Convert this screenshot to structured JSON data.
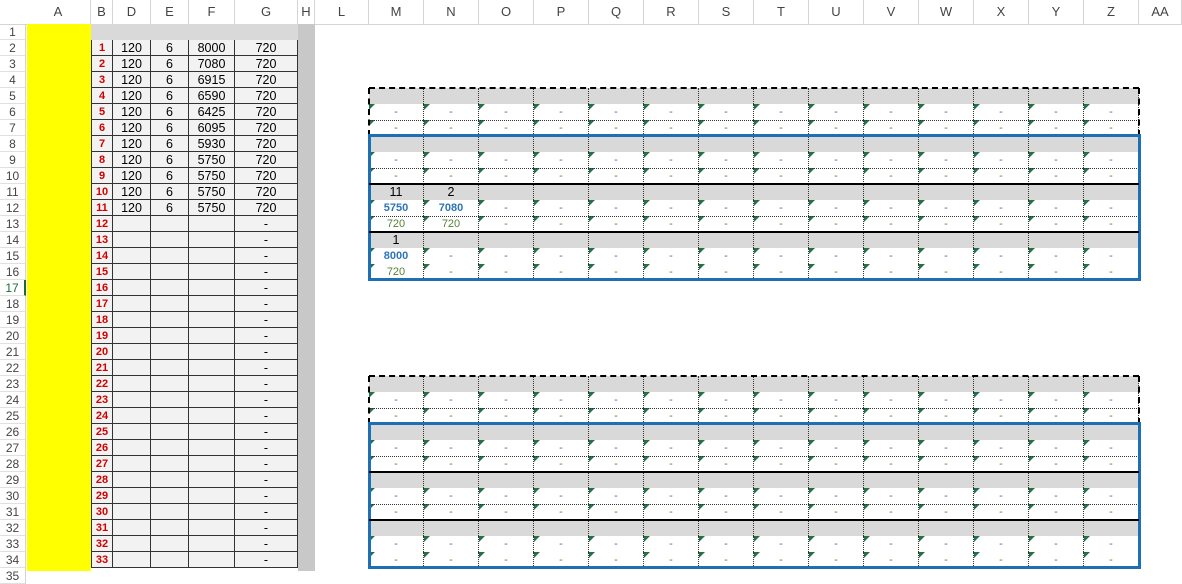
{
  "columns": [
    "A",
    "B",
    "D",
    "E",
    "F",
    "G",
    "H",
    "L",
    "M",
    "N",
    "O",
    "P",
    "Q",
    "R",
    "S",
    "T",
    "U",
    "V",
    "W",
    "X",
    "Y",
    "Z",
    "AA"
  ],
  "rows": [
    "1",
    "2",
    "3",
    "4",
    "5",
    "6",
    "7",
    "8",
    "9",
    "10",
    "11",
    "12",
    "13",
    "14",
    "15",
    "16",
    "17",
    "18",
    "19",
    "20",
    "21",
    "22",
    "23",
    "24",
    "25",
    "26",
    "27",
    "28",
    "29",
    "30",
    "31",
    "32",
    "33",
    "34",
    "35"
  ],
  "selected_row": "17",
  "left_table": {
    "rows": [
      {
        "idx": "1",
        "d": "120",
        "e": "6",
        "f": "8000",
        "g": "720"
      },
      {
        "idx": "2",
        "d": "120",
        "e": "6",
        "f": "7080",
        "g": "720"
      },
      {
        "idx": "3",
        "d": "120",
        "e": "6",
        "f": "6915",
        "g": "720"
      },
      {
        "idx": "4",
        "d": "120",
        "e": "6",
        "f": "6590",
        "g": "720"
      },
      {
        "idx": "5",
        "d": "120",
        "e": "6",
        "f": "6425",
        "g": "720"
      },
      {
        "idx": "6",
        "d": "120",
        "e": "6",
        "f": "6095",
        "g": "720"
      },
      {
        "idx": "7",
        "d": "120",
        "e": "6",
        "f": "5930",
        "g": "720"
      },
      {
        "idx": "8",
        "d": "120",
        "e": "6",
        "f": "5750",
        "g": "720"
      },
      {
        "idx": "9",
        "d": "120",
        "e": "6",
        "f": "5750",
        "g": "720"
      },
      {
        "idx": "10",
        "d": "120",
        "e": "6",
        "f": "5750",
        "g": "720"
      },
      {
        "idx": "11",
        "d": "120",
        "e": "6",
        "f": "5750",
        "g": "720"
      },
      {
        "idx": "12",
        "d": "",
        "e": "",
        "f": "",
        "g": "-"
      },
      {
        "idx": "13",
        "d": "",
        "e": "",
        "f": "",
        "g": "-"
      },
      {
        "idx": "14",
        "d": "",
        "e": "",
        "f": "",
        "g": "-"
      },
      {
        "idx": "15",
        "d": "",
        "e": "",
        "f": "",
        "g": "-"
      },
      {
        "idx": "16",
        "d": "",
        "e": "",
        "f": "",
        "g": "-"
      },
      {
        "idx": "17",
        "d": "",
        "e": "",
        "f": "",
        "g": "-"
      },
      {
        "idx": "18",
        "d": "",
        "e": "",
        "f": "",
        "g": "-"
      },
      {
        "idx": "19",
        "d": "",
        "e": "",
        "f": "",
        "g": "-"
      },
      {
        "idx": "20",
        "d": "",
        "e": "",
        "f": "",
        "g": "-"
      },
      {
        "idx": "21",
        "d": "",
        "e": "",
        "f": "",
        "g": "-"
      },
      {
        "idx": "22",
        "d": "",
        "e": "",
        "f": "",
        "g": "-"
      },
      {
        "idx": "23",
        "d": "",
        "e": "",
        "f": "",
        "g": "-"
      },
      {
        "idx": "24",
        "d": "",
        "e": "",
        "f": "",
        "g": "-"
      },
      {
        "idx": "25",
        "d": "",
        "e": "",
        "f": "",
        "g": "-"
      },
      {
        "idx": "26",
        "d": "",
        "e": "",
        "f": "",
        "g": "-"
      },
      {
        "idx": "27",
        "d": "",
        "e": "",
        "f": "",
        "g": "-"
      },
      {
        "idx": "28",
        "d": "",
        "e": "",
        "f": "",
        "g": "-"
      },
      {
        "idx": "29",
        "d": "",
        "e": "",
        "f": "",
        "g": "-"
      },
      {
        "idx": "30",
        "d": "",
        "e": "",
        "f": "",
        "g": "-"
      },
      {
        "idx": "31",
        "d": "",
        "e": "",
        "f": "",
        "g": "-"
      },
      {
        "idx": "32",
        "d": "",
        "e": "",
        "f": "",
        "g": "-"
      },
      {
        "idx": "33",
        "d": "",
        "e": "",
        "f": "",
        "g": "-"
      }
    ]
  },
  "right_table_1": {
    "dash": "-",
    "labels": {
      "n11_m": "11",
      "n11_n": "2",
      "n14_m": "1"
    },
    "values": {
      "r12_m": "5750",
      "r12_n": "7080",
      "r13_m": "720",
      "r13_n": "720",
      "r15_m": "8000",
      "r16_m": "720"
    }
  },
  "right_table_2": {
    "dash": "-"
  },
  "colors": {
    "yellow": "#ffff00",
    "blue_box": "#1f6fb5",
    "red_index": "#d00000",
    "green_tri": "#217346"
  }
}
